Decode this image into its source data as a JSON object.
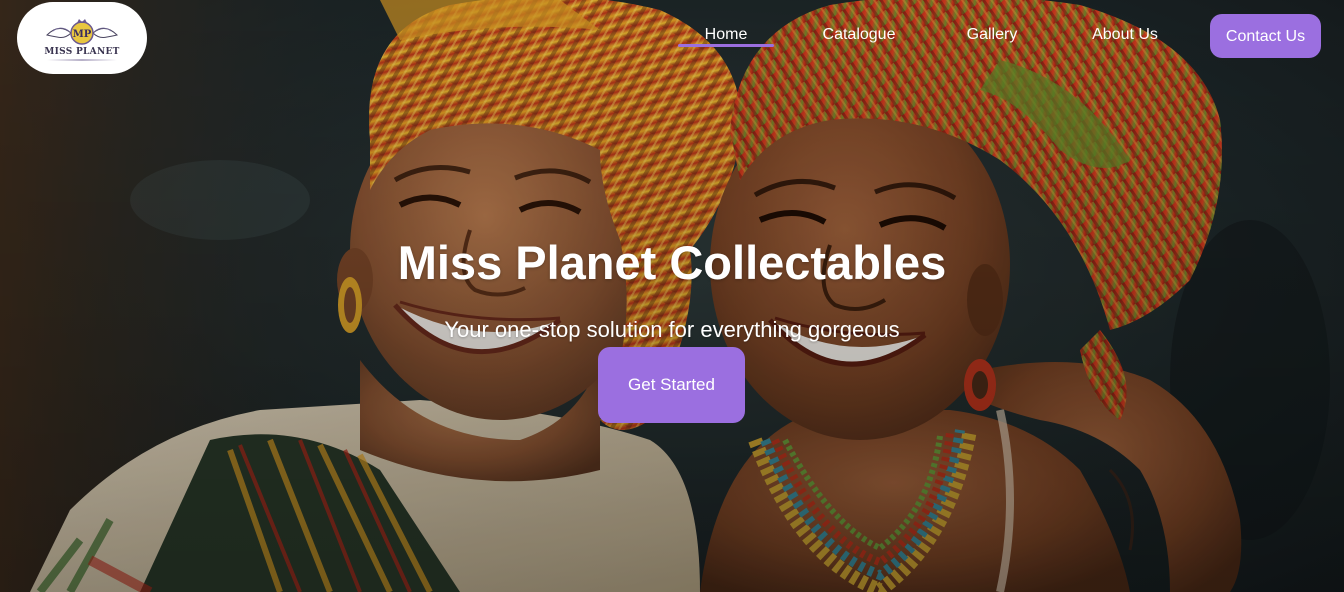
{
  "logo": {
    "monogram": "MP",
    "text": "MISS PLANET"
  },
  "nav": {
    "items": [
      {
        "label": "Home",
        "active": true
      },
      {
        "label": "Catalogue",
        "active": false
      },
      {
        "label": "Gallery",
        "active": false
      },
      {
        "label": "About Us",
        "active": false
      }
    ],
    "contact_label": "Contact Us"
  },
  "hero": {
    "title": "Miss Planet Collectables",
    "subtitle": "Your one-stop solution for everything gorgeous",
    "cta_label": "Get Started"
  },
  "colors": {
    "accent": "#9b6fe0",
    "text": "#ffffff",
    "logo_bg": "#ffffff"
  }
}
